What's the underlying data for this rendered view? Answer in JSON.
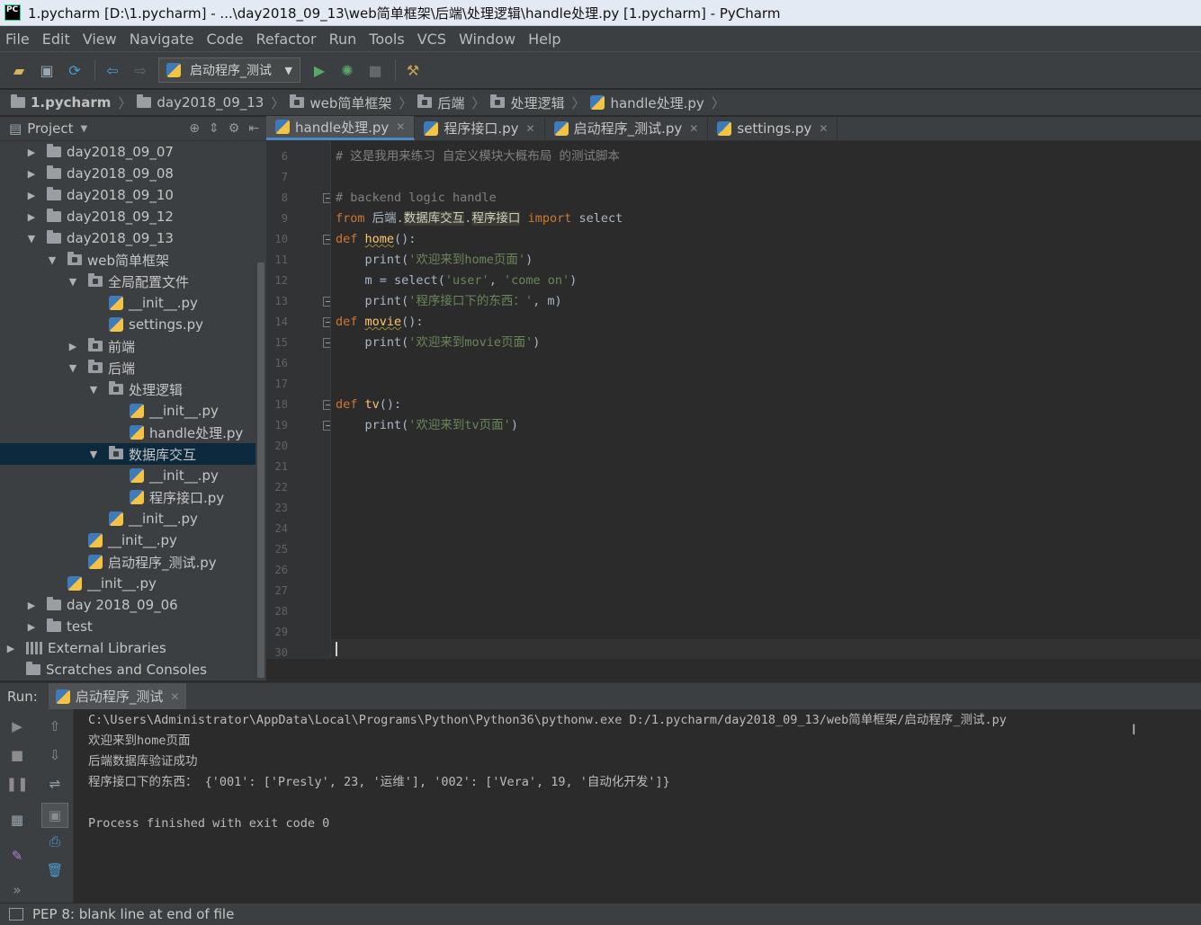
{
  "window": {
    "title": "1.pycharm [D:\\1.pycharm] - ...\\day2018_09_13\\web简单框架\\后端\\处理逻辑\\handle处理.py [1.pycharm] - PyCharm",
    "icon_text": "PC"
  },
  "menu": [
    "File",
    "Edit",
    "View",
    "Navigate",
    "Code",
    "Refactor",
    "Run",
    "Tools",
    "VCS",
    "Window",
    "Help"
  ],
  "toolbar": {
    "run_config": "启动程序_测试"
  },
  "breadcrumb": [
    "1.pycharm",
    "day2018_09_13",
    "web简单框架",
    "后端",
    "处理逻辑",
    "handle处理.py"
  ],
  "project": {
    "label": "Project",
    "tree": [
      {
        "text": "day2018_09_07",
        "icon": "folder",
        "arrow": "▶",
        "indent": 28
      },
      {
        "text": "day2018_09_08",
        "icon": "folder",
        "arrow": "▶",
        "indent": 28
      },
      {
        "text": "day2018_09_10",
        "icon": "folder",
        "arrow": "▶",
        "indent": 28
      },
      {
        "text": "day2018_09_12",
        "icon": "folder",
        "arrow": "▶",
        "indent": 28
      },
      {
        "text": "day2018_09_13",
        "icon": "folder",
        "arrow": "▼",
        "indent": 28
      },
      {
        "text": "web简单框架",
        "icon": "package",
        "arrow": "▼",
        "indent": 51
      },
      {
        "text": "全局配置文件",
        "icon": "package",
        "arrow": "▼",
        "indent": 74
      },
      {
        "text": "__init__.py",
        "icon": "python",
        "arrow": "",
        "indent": 97
      },
      {
        "text": "settings.py",
        "icon": "python",
        "arrow": "",
        "indent": 97
      },
      {
        "text": "前端",
        "icon": "package",
        "arrow": "▶",
        "indent": 74
      },
      {
        "text": "后端",
        "icon": "package",
        "arrow": "▼",
        "indent": 74
      },
      {
        "text": "处理逻辑",
        "icon": "package",
        "arrow": "▼",
        "indent": 97
      },
      {
        "text": "__init__.py",
        "icon": "python",
        "arrow": "",
        "indent": 120
      },
      {
        "text": "handle处理.py",
        "icon": "python",
        "arrow": "",
        "indent": 120
      },
      {
        "text": "数据库交互",
        "icon": "package",
        "arrow": "▼",
        "indent": 97,
        "selected": true
      },
      {
        "text": "__init__.py",
        "icon": "python",
        "arrow": "",
        "indent": 120
      },
      {
        "text": "程序接口.py",
        "icon": "python",
        "arrow": "",
        "indent": 120
      },
      {
        "text": "__init__.py",
        "icon": "python",
        "arrow": "",
        "indent": 97
      },
      {
        "text": "__init__.py",
        "icon": "python",
        "arrow": "",
        "indent": 74
      },
      {
        "text": "启动程序_测试.py",
        "icon": "python",
        "arrow": "",
        "indent": 74
      },
      {
        "text": "__init__.py",
        "icon": "python",
        "arrow": "",
        "indent": 51
      },
      {
        "text": "day 2018_09_06",
        "icon": "folder",
        "arrow": "▶",
        "indent": 28
      },
      {
        "text": "test",
        "icon": "folder",
        "arrow": "▶",
        "indent": 28
      },
      {
        "text": "External Libraries",
        "icon": "library",
        "arrow": "▶",
        "indent": 5
      },
      {
        "text": "Scratches and Consoles",
        "icon": "scratch",
        "arrow": "",
        "indent": 5
      }
    ]
  },
  "tabs": [
    {
      "label": "handle处理.py",
      "active": true
    },
    {
      "label": "程序接口.py",
      "active": false
    },
    {
      "label": "启动程序_测试.py",
      "active": false
    },
    {
      "label": "settings.py",
      "active": false
    }
  ],
  "editor": {
    "line_numbers": [
      "6",
      "7",
      "8",
      "9",
      "10",
      "11",
      "12",
      "13",
      "14",
      "15",
      "16",
      "17",
      "18",
      "19",
      "20",
      "21",
      "22",
      "23",
      "24",
      "25",
      "26",
      "27",
      "28",
      "29",
      "30"
    ],
    "code": {
      "l6": "# 这是我用来练习 自定义模块大概布局 的测试脚本",
      "l8": "# backend logic handle",
      "l9_from": "from",
      "l9_pkg": "后端",
      "l9_dot1": ".",
      "l9_mod1": "数据库交互",
      "l9_dot2": ".",
      "l9_mod2": "程序接口",
      "l9_import": "import",
      "l9_name": "select",
      "l10_def": "def",
      "l10_fn": "home",
      "l10_rest": "():",
      "l11_print": "print(",
      "l11_str": "'欢迎来到home页面'",
      "l11_end": ")",
      "l12_a": "m = select(",
      "l12_s1": "'user'",
      "l12_c": ", ",
      "l12_s2": "'come on'",
      "l12_end": ")",
      "l13_print": "print(",
      "l13_str": "'程序接口下的东西：'",
      "l13_end": ", m)",
      "l14_def": "def",
      "l14_fn": "movie",
      "l14_rest": "():",
      "l15_print": "print(",
      "l15_str": "'欢迎来到movie页面'",
      "l15_end": ")",
      "l18_def": "def",
      "l18_fn": "tv",
      "l18_rest": "():",
      "l19_print": "print(",
      "l19_str": "'欢迎来到tv页面'",
      "l19_end": ")"
    }
  },
  "run": {
    "label": "Run:",
    "tab": "启动程序_测试",
    "console": [
      "C:\\Users\\Administrator\\AppData\\Local\\Programs\\Python\\Python36\\pythonw.exe D:/1.pycharm/day2018_09_13/web简单框架/启动程序_测试.py",
      "欢迎来到home页面",
      "后端数据库验证成功",
      "程序接口下的东西： {'001': ['Presly', 23, '运维'], '002': ['Vera', 19, '自动化开发']}",
      "",
      "Process finished with exit code 0"
    ]
  },
  "status": {
    "message": "PEP 8: blank line at end of file"
  }
}
